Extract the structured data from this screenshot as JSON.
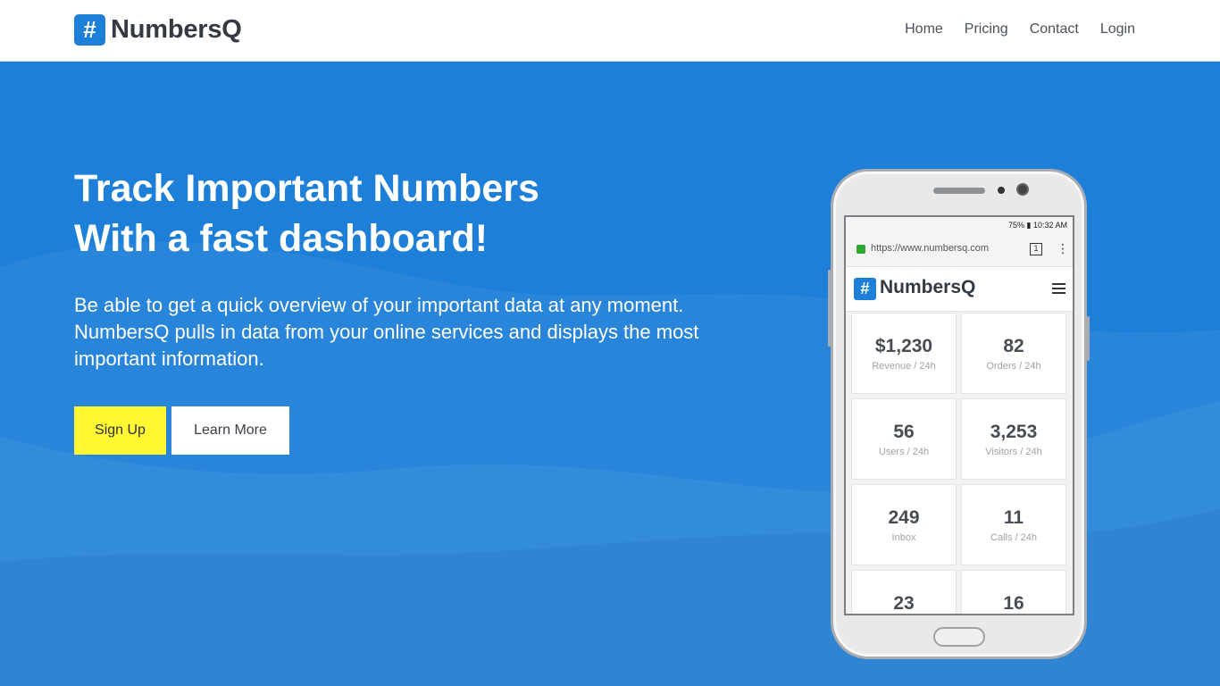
{
  "header": {
    "brand_mark": "#",
    "brand_name": "NumbersQ",
    "nav": [
      "Home",
      "Pricing",
      "Contact",
      "Login"
    ]
  },
  "hero": {
    "headline_line1": "Track Important Numbers",
    "headline_line2": "With a fast dashboard!",
    "lead": "Be able to get a quick overview of your important data at any moment. NumbersQ pulls in data from your online services and displays the most important information.",
    "signup_label": "Sign Up",
    "learn_more_label": "Learn More"
  },
  "phone": {
    "status": "75% ▮ 10:32 AM",
    "url": "https://www.numbersq.com",
    "tab_count": "1",
    "app_mark": "#",
    "app_name": "NumbersQ",
    "tiles": [
      {
        "value": "$1,230",
        "label": "Revenue / 24h"
      },
      {
        "value": "82",
        "label": "Orders / 24h"
      },
      {
        "value": "56",
        "label": "Users / 24h"
      },
      {
        "value": "3,253",
        "label": "Visitors / 24h"
      },
      {
        "value": "249",
        "label": "Inbox"
      },
      {
        "value": "11",
        "label": "Calls / 24h"
      },
      {
        "value": "23",
        "label": ""
      },
      {
        "value": "16",
        "label": ""
      }
    ]
  },
  "colors": {
    "brand_blue": "#1e7fd8",
    "signup_yellow": "#fff833",
    "heading_dark": "#333a44"
  },
  "icons": [
    "hash-logo-icon",
    "lock-icon",
    "tabs-icon",
    "kebab-menu-icon",
    "hamburger-menu-icon"
  ]
}
